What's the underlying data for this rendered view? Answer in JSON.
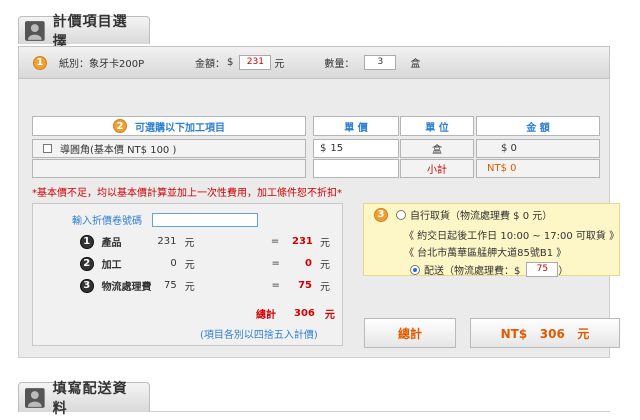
{
  "section1": {
    "title": "計價項目選擇"
  },
  "topbar": {
    "step": "1",
    "paper_label": "紙別：象牙卡200P",
    "amount_label": "金額：",
    "amount_currency": "$",
    "amount_value": "231",
    "amount_unit": "元",
    "qty_label": "數量：",
    "qty_value": "3",
    "qty_unit": "盒"
  },
  "items": {
    "step": "2",
    "header_optional": "可選購以下加工項目",
    "header_unit_price": "單 價",
    "header_unit": "單 位",
    "header_amount": "金 額",
    "row_label": "導圓角(基本價 NT$ 100 )",
    "row_price_currency": "$",
    "row_price": "15",
    "row_unit": "盒",
    "row_amount": "$ 0",
    "subtotal_label": "小計",
    "subtotal_value": "NT$ 0"
  },
  "note": "*基本價不足，均以基本價計算並加上一次性費用，加工條件恕不折扣*",
  "calc": {
    "coupon_label": "輸入折價卷號碼",
    "coupon_value": "",
    "lines": [
      {
        "num": "1",
        "label": "產品",
        "value": "231",
        "unit": "元",
        "eq": "=",
        "result": "231",
        "result_unit": "元"
      },
      {
        "num": "2",
        "label": "加工",
        "value": "0",
        "unit": "元",
        "eq": "=",
        "result": "0",
        "result_unit": "元"
      },
      {
        "num": "3",
        "label": "物流處理費",
        "value": "75",
        "unit": "元",
        "eq": "=",
        "result": "75",
        "result_unit": "元"
      }
    ],
    "total_label": "總計",
    "total_value": "306",
    "total_unit": "元",
    "rounding_note": "(項目各別以四捨五入計價)"
  },
  "shipping": {
    "step": "3",
    "pickup_label": "自行取貨（物流處理費 $ 0 元）",
    "pickup_note1": "《 約交日起後工作日 10:00 ~ 17:00 可取貨 》",
    "pickup_note2": "《 台北市萬華區艋舺大道85號B1 》",
    "delivery_label": "配送（物流處理費：$",
    "delivery_value": "75",
    "delivery_close": "）"
  },
  "summary": {
    "total_button": "總計",
    "total_display": "NT$   306   元"
  },
  "section2": {
    "title": "填寫配送資料"
  }
}
